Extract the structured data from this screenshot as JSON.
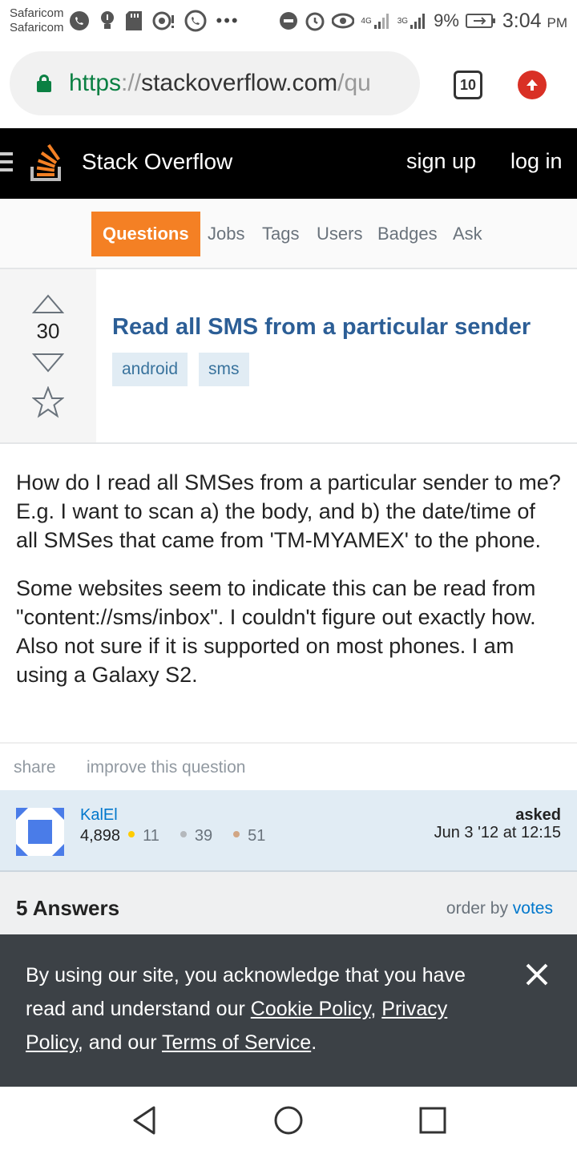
{
  "status_bar": {
    "carrier_1": "Safaricom",
    "carrier_2": "Safaricom",
    "network_4g": "4G",
    "network_3g": "3G",
    "battery": "9%",
    "time": "3:04",
    "ampm": "PM",
    "icons": [
      "whatsapp-icon",
      "bulb-icon",
      "sd-card-icon",
      "camera-icon",
      "whatsapp-icon",
      "more-icon",
      "dnd-icon",
      "alarm-icon",
      "eye-icon",
      "signal-icon",
      "battery-icon"
    ]
  },
  "browser": {
    "url_scheme": "https",
    "url_sep": "://",
    "url_host": "stackoverflow.com",
    "url_path": "/qu",
    "tab_count": "10",
    "accent": "#0b8043"
  },
  "topbar": {
    "brand": "Stack Overflow",
    "signup": "sign up",
    "login": "log in"
  },
  "nav": {
    "items": [
      "Questions",
      "Jobs",
      "Tags",
      "Users",
      "Badges",
      "Ask"
    ],
    "active_color": "#f48024"
  },
  "question": {
    "votes": "30",
    "title": "Read all SMS from a particular sender",
    "tags": [
      "android",
      "sms"
    ],
    "body": [
      "How do I read all SMSes from a particular sender to me? E.g. I want to scan a) the body, and b) the date/time of all SMSes that came from 'TM-MYAMEX' to the phone.",
      "Some websites seem to indicate this can be read from \"content://sms/inbox\". I couldn't figure out exactly how. Also not sure if it is supported on most phones. I am using a Galaxy S2."
    ],
    "share": "share",
    "improve": "improve this question"
  },
  "user": {
    "name": "KalEl",
    "reputation": "4,898",
    "gold": "11",
    "silver": "39",
    "bronze": "51",
    "asked_label": "asked",
    "asked_date": "Jun 3 '12 at 12:15"
  },
  "answers": {
    "count_label": "5 Answers",
    "order_prefix": "order by",
    "order_value": "votes"
  },
  "cookie": {
    "text_1": "By using our site, you acknowledge that you have read and understand our ",
    "cookie_policy": "Cookie Policy",
    "comma": ", ",
    "privacy_policy": "Privacy Policy",
    "text_2": ", and our ",
    "terms": "Terms of Service",
    "period": "."
  }
}
